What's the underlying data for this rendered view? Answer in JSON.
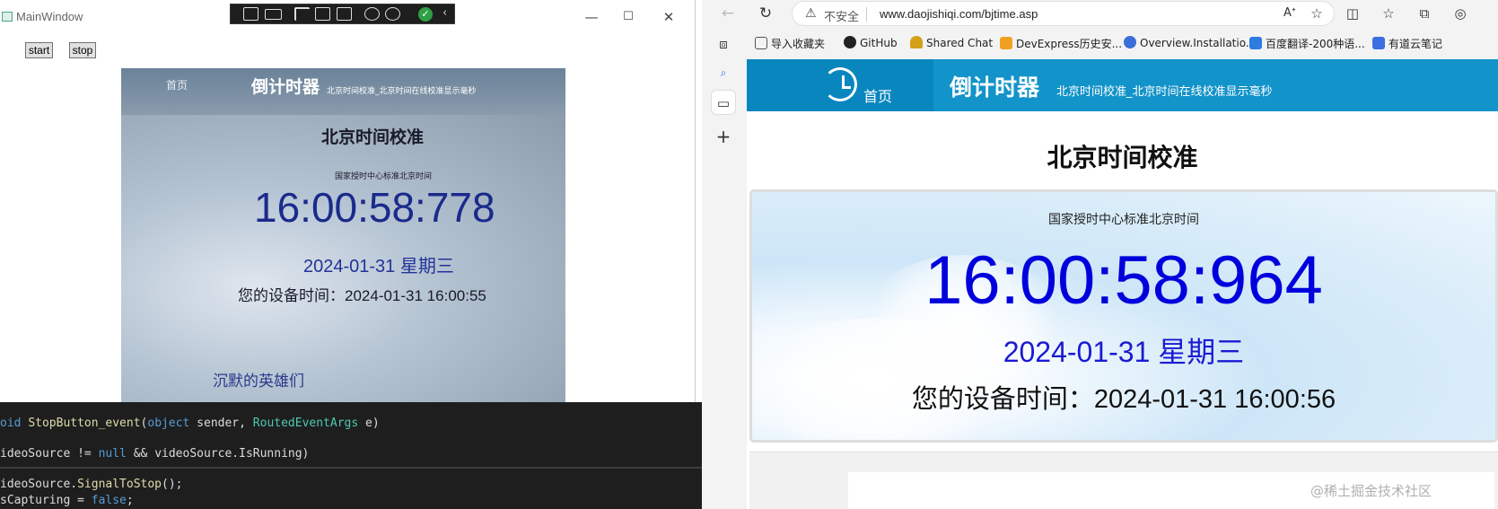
{
  "left_window": {
    "title": "MainWindow",
    "start_label": "start",
    "stop_label": "stop",
    "controls": {
      "minimize": "—",
      "maximize": "☐",
      "close": "✕"
    },
    "video": {
      "home": "首页",
      "site_title": "倒计时器",
      "site_sub": "北京时间校准_北京时间在线校准显示毫秒",
      "heading": "北京时间校准",
      "caption": "国家授时中心标准北京时间",
      "time": "16:00:58:778",
      "date": "2024-01-31 星期三",
      "device_time": "您的设备时间：2024-01-31 16:00:55",
      "footer_text": "沉默的英雄们"
    }
  },
  "code": {
    "line1_kw": "oid",
    "line1_fn": "StopButton_event",
    "line1_p1": "(",
    "line1_kw2": "object",
    "line1_p2": " sender, ",
    "line1_ty": "RoutedEventArgs",
    "line1_p3": " e)",
    "line2_a": "ideoSource != ",
    "line2_kw": "null",
    "line2_b": " && videoSource.IsRunning)",
    "line3_a": "ideoSource.",
    "line3_fn": "SignalToStop",
    "line3_b": "();",
    "line4_a": "sCapturing = ",
    "line4_kw": "false",
    "line4_b": ";"
  },
  "browser": {
    "insecure_label": "不安全",
    "url": "www.daojishiqi.com/bjtime.asp",
    "bookmarks": [
      {
        "label": "导入收藏夹",
        "color": "#f1b841"
      },
      {
        "label": "GitHub",
        "color": "#222222"
      },
      {
        "label": "Shared Chat",
        "color": "#d4a017"
      },
      {
        "label": "DevExpress历史安...",
        "color": "#f0a020"
      },
      {
        "label": "Overview.Installatio...",
        "color": "#3a6fd8"
      },
      {
        "label": "百度翻译-200种语...",
        "color": "#2d7de0"
      },
      {
        "label": "有道云笔记",
        "color": "#3b6fe0"
      }
    ],
    "page": {
      "home": "首页",
      "site_title": "倒计时器",
      "site_sub": "北京时间校准_北京时间在线校准显示毫秒",
      "heading": "北京时间校准",
      "caption": "国家授时中心标准北京时间",
      "time": "16:00:58:964",
      "date": "2024-01-31 星期三",
      "device_time": "您的设备时间：2024-01-31 16:00:56"
    }
  },
  "watermark": "@稀土掘金技术社区",
  "colors": {
    "site_blue": "#1293c9",
    "time_blue": "#0000dd",
    "editor_bg": "#1e1e1e"
  }
}
